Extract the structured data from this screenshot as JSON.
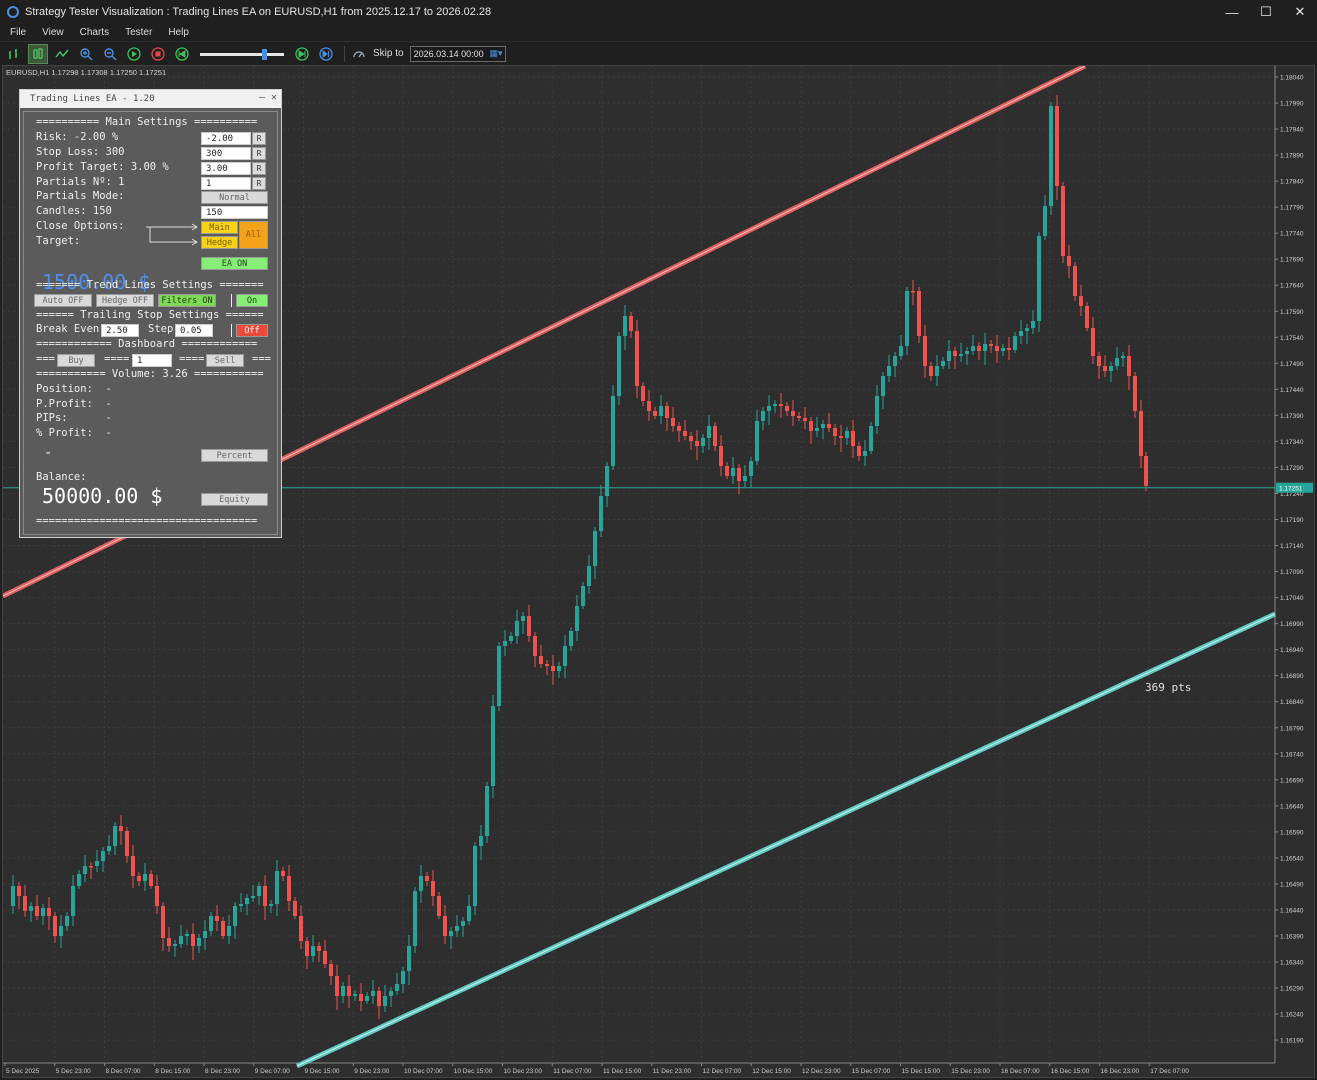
{
  "window": {
    "title": "Strategy Tester Visualization : Trading Lines EA on EURUSD,H1 from 2025.12.17 to 2026.02.28",
    "minimize": "—",
    "maximize": "☐",
    "close": "✕"
  },
  "menu": [
    "File",
    "View",
    "Charts",
    "Tester",
    "Help"
  ],
  "toolbar": {
    "skip_label": "Skip to",
    "skip_date": "2026.03.14 00:00"
  },
  "chart": {
    "symbol_info": "EURUSD,H1  1.17298 1.17308 1.17250 1.17251",
    "current_price": "1.17251",
    "pts_label": "369 pts",
    "price_labels": [
      "1.18040",
      "1.17990",
      "1.17940",
      "1.17890",
      "1.17840",
      "1.17790",
      "1.17740",
      "1.17690",
      "1.17640",
      "1.17590",
      "1.17540",
      "1.17490",
      "1.17440",
      "1.17390",
      "1.17340",
      "1.17290",
      "1.17240",
      "1.17190",
      "1.17140",
      "1.17090",
      "1.17040",
      "1.16990",
      "1.16940",
      "1.16890",
      "1.16840",
      "1.16790",
      "1.16740",
      "1.16690",
      "1.16640",
      "1.16590",
      "1.16540",
      "1.16490",
      "1.16440",
      "1.16390",
      "1.16340",
      "1.16290",
      "1.16240",
      "1.16190"
    ],
    "time_labels": [
      "5 Dec 2025",
      "5 Dec 23:00",
      "8 Dec 07:00",
      "8 Dec 15:00",
      "8 Dec 23:00",
      "9 Dec 07:00",
      "9 Dec 15:00",
      "9 Dec 23:00",
      "10 Dec 07:00",
      "10 Dec 15:00",
      "10 Dec 23:00",
      "11 Dec 07:00",
      "11 Dec 15:00",
      "11 Dec 23:00",
      "12 Dec 07:00",
      "12 Dec 15:00",
      "12 Dec 23:00",
      "15 Dec 07:00",
      "15 Dec 15:00",
      "15 Dec 23:00",
      "16 Dec 07:00",
      "16 Dec 15:00",
      "16 Dec 23:00",
      "17 Dec 07:00"
    ],
    "colors": {
      "bull": "#26a69a",
      "bear": "#ef5350",
      "upper_line": "#e06060",
      "lower_line": "#5ec8c0",
      "price_line": "#26a69a"
    }
  },
  "ea": {
    "title": "Trading Lines EA - 1.20",
    "header_min": "—",
    "header_close": "✕",
    "main_settings_sep": "========== Main Settings ==========",
    "risk_label": "Risk: -2.00 %",
    "risk_value": "-2.00",
    "stop_loss_label": "Stop Loss: 300",
    "stop_loss_value": "300",
    "profit_target_label": "Profit Target: 3.00 %",
    "profit_target_value": "3.00",
    "partials_no_label": "Partials Nº: 1",
    "partials_no_value": "1",
    "reset_label": "R",
    "partials_mode_label": "Partials Mode:",
    "partials_mode_value": "Normal",
    "candles_label": "Candles: 150",
    "candles_value": "150",
    "close_options_label": "Close Options:",
    "target_label": "Target:",
    "main_btn": "Main",
    "hedge_btn": "Hedge",
    "all_btn": "All",
    "money_value": "1500.00 $",
    "ea_on_btn": "EA ON",
    "trend_sep": "======= Trend Lines Settings =======",
    "auto_btn": "Auto OFF",
    "hedge_off_btn": "Hedge OFF",
    "filters_btn": "Filters ON",
    "trend_on_btn": "On",
    "trailing_sep": "====== Trailing Stop Settings ======",
    "break_even_label": "Break Even",
    "break_even_value": "2.50",
    "step_label": "Step",
    "step_value": "0.05",
    "trailing_off_btn": "Off",
    "dashboard_sep": "============ Dashboard ============",
    "dash_left": "===",
    "dash_mid1": "====",
    "dash_mid2": "====",
    "dash_right": "===",
    "buy_btn": "Buy",
    "lot_value": "1",
    "sell_btn": "Sell",
    "volume_sep": "=========== Volume: 3.26 ===========",
    "position_label": "Position:  -",
    "pprofit_label": "P.Profit:  -",
    "pips_label": "PIPs:      -",
    "pct_profit_label": "% Profit:  -",
    "dash_value": "-",
    "percent_btn": "Percent",
    "balance_label": "Balance:",
    "balance_value": "50000.00 $",
    "equity_btn": "Equity",
    "bottom_sep": "==================================="
  }
}
